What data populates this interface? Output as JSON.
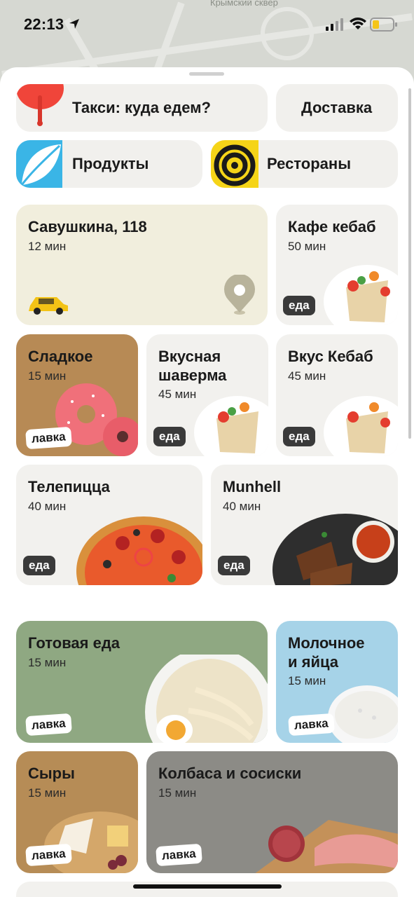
{
  "status_bar": {
    "time": "22:13"
  },
  "map": {
    "label": "Крымский сквер"
  },
  "top_pills": {
    "taxi": "Такси: куда едем?",
    "delivery": "Доставка",
    "products": "Продукты",
    "restaurants": "Рестораны"
  },
  "cards": [
    {
      "title": "Савушкина, 118",
      "time": "12 мин"
    },
    {
      "title": "Кафе кебаб",
      "time": "50 мин",
      "badge": "еда"
    },
    {
      "title": "Сладкое",
      "time": "15 мин",
      "badge": "лавка"
    },
    {
      "title": "Вкусная\nшаверма",
      "time": "45 мин",
      "badge": "еда"
    },
    {
      "title": "Вкус Кебаб",
      "time": "45 мин",
      "badge": "еда"
    },
    {
      "title": "Телепицца",
      "time": "40 мин",
      "badge": "еда"
    },
    {
      "title": "Munhell",
      "time": "40 мин",
      "badge": "еда"
    },
    {
      "title": "Готовая еда",
      "time": "15 мин",
      "badge": "лавка"
    },
    {
      "title": "Молочное\nи яйца",
      "time": "15 мин",
      "badge": "лавка"
    },
    {
      "title": "Сыры",
      "time": "15 мин",
      "badge": "лавка"
    },
    {
      "title": "Колбаса и сосиски",
      "time": "15 мин",
      "badge": "лавка"
    }
  ]
}
